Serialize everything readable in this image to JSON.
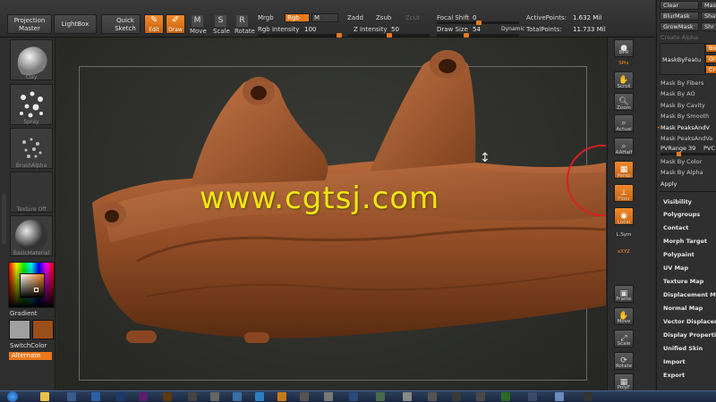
{
  "toolbar": {
    "projection_master": "Projection Master",
    "lightbox": "LightBox",
    "quick_sketch": "Quick Sketch",
    "edit": "Edit",
    "draw": "Draw",
    "move": "Move",
    "scale": "Scale",
    "rotate": "Rotate",
    "mrgb": "Mrgb",
    "rgb": "Rgb",
    "m": "M",
    "rgb_intensity_label": "Rgb Intensity",
    "rgb_intensity_value": "100",
    "zadd": "Zadd",
    "zsub": "Zsub",
    "zcut": "Zcut",
    "z_intensity_label": "Z Intensity",
    "z_intensity_value": "50",
    "focal_shift_label": "Focal Shift",
    "focal_shift_value": "0",
    "draw_size_label": "Draw Size",
    "draw_size_value": "54",
    "dynamic": "Dynamic",
    "active_points_label": "ActivePoints:",
    "active_points_value": "1.632 Mil",
    "total_points_label": "TotalPoints:",
    "total_points_value": "11.733 Mil"
  },
  "left_shelf": {
    "items": [
      {
        "label": "Clay"
      },
      {
        "label": "Spray"
      },
      {
        "label": "BrushAlpha"
      },
      {
        "label": "Texture Off"
      },
      {
        "label": "BasicMaterial"
      }
    ],
    "gradient": "Gradient",
    "switch_color": "SwitchColor",
    "alternate": "Alternate"
  },
  "viewport": {
    "watermark": "www.cgtsj.com"
  },
  "right_shelf": {
    "items": [
      {
        "label": "BPR",
        "icon": "bpr-icon"
      },
      {
        "label": "SPix",
        "icon": "spix-icon"
      },
      {
        "label": "Scroll",
        "icon": "scroll-icon"
      },
      {
        "label": "Zoom",
        "icon": "zoom-icon"
      },
      {
        "label": "Actual",
        "icon": "actual-icon"
      },
      {
        "label": "AAHalf",
        "icon": "aahalf-icon"
      },
      {
        "label": "Persp",
        "icon": "persp-icon"
      },
      {
        "label": "Floor",
        "icon": "floor-icon"
      },
      {
        "label": "Local",
        "icon": "local-icon"
      },
      {
        "label": "L.Sym",
        "icon": "lsym-icon"
      },
      {
        "label": "xXYZ",
        "icon": "xyz-icon"
      },
      {
        "label": "Frame",
        "icon": "frame-icon"
      },
      {
        "label": "Move",
        "icon": "move-icon"
      },
      {
        "label": "Scale",
        "icon": "scale-icon"
      },
      {
        "label": "Rotate",
        "icon": "rotate-icon"
      },
      {
        "label": "PolyF",
        "icon": "polyf-icon"
      }
    ]
  },
  "right_panel": {
    "clear": "Clear",
    "mask_top": "Mas",
    "blur_mask": "BlurMask",
    "sharpen": "Sha",
    "grow_mask": "GrowMask",
    "shrink": "Shr",
    "create_alpha": "Create Alpha",
    "mask_by_feature": "MaskByFeatu",
    "border": "Bor",
    "groups": "Gro",
    "crease": "Cre",
    "mask_items": [
      "Mask By Fibers",
      "Mask By AO",
      "Mask By Cavity",
      "Mask By Smooth",
      "Mask PeaksAndV",
      "Mask PeaksAndVa"
    ],
    "pv_range": "PVRange 39",
    "pvc": "PVC",
    "mask_by_color": "Mask By Color",
    "mask_by_alpha": "Mask By Alpha",
    "apply": "Apply",
    "menus": [
      "Visibility",
      "Polygroups",
      "Contact",
      "Morph Target",
      "Polypaint",
      "UV Map",
      "Texture Map",
      "Displacement Ma",
      "Normal Map",
      "Vector Displacem",
      "Display Properti",
      "Unified Skin",
      "Import",
      "Export"
    ]
  },
  "colors": {
    "accent": "#e8781c",
    "clay": "#8a4a24",
    "watermark": "#f2e414",
    "gizmo": "#d82020"
  }
}
